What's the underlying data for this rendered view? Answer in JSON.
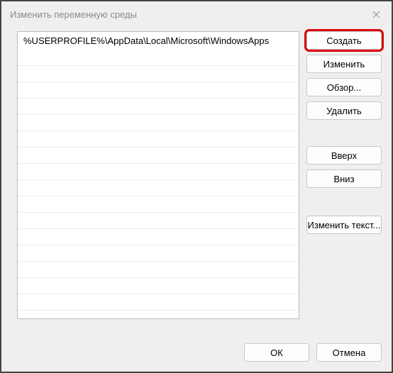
{
  "title": "Изменить переменную среды",
  "list": {
    "items": [
      "%USERPROFILE%\\AppData\\Local\\Microsoft\\WindowsApps"
    ]
  },
  "buttons": {
    "create": "Создать",
    "edit": "Изменить",
    "browse": "Обзор...",
    "delete": "Удалить",
    "up": "Вверх",
    "down": "Вниз",
    "edit_text": "Изменить текст...",
    "ok": "ОК",
    "cancel": "Отмена"
  }
}
